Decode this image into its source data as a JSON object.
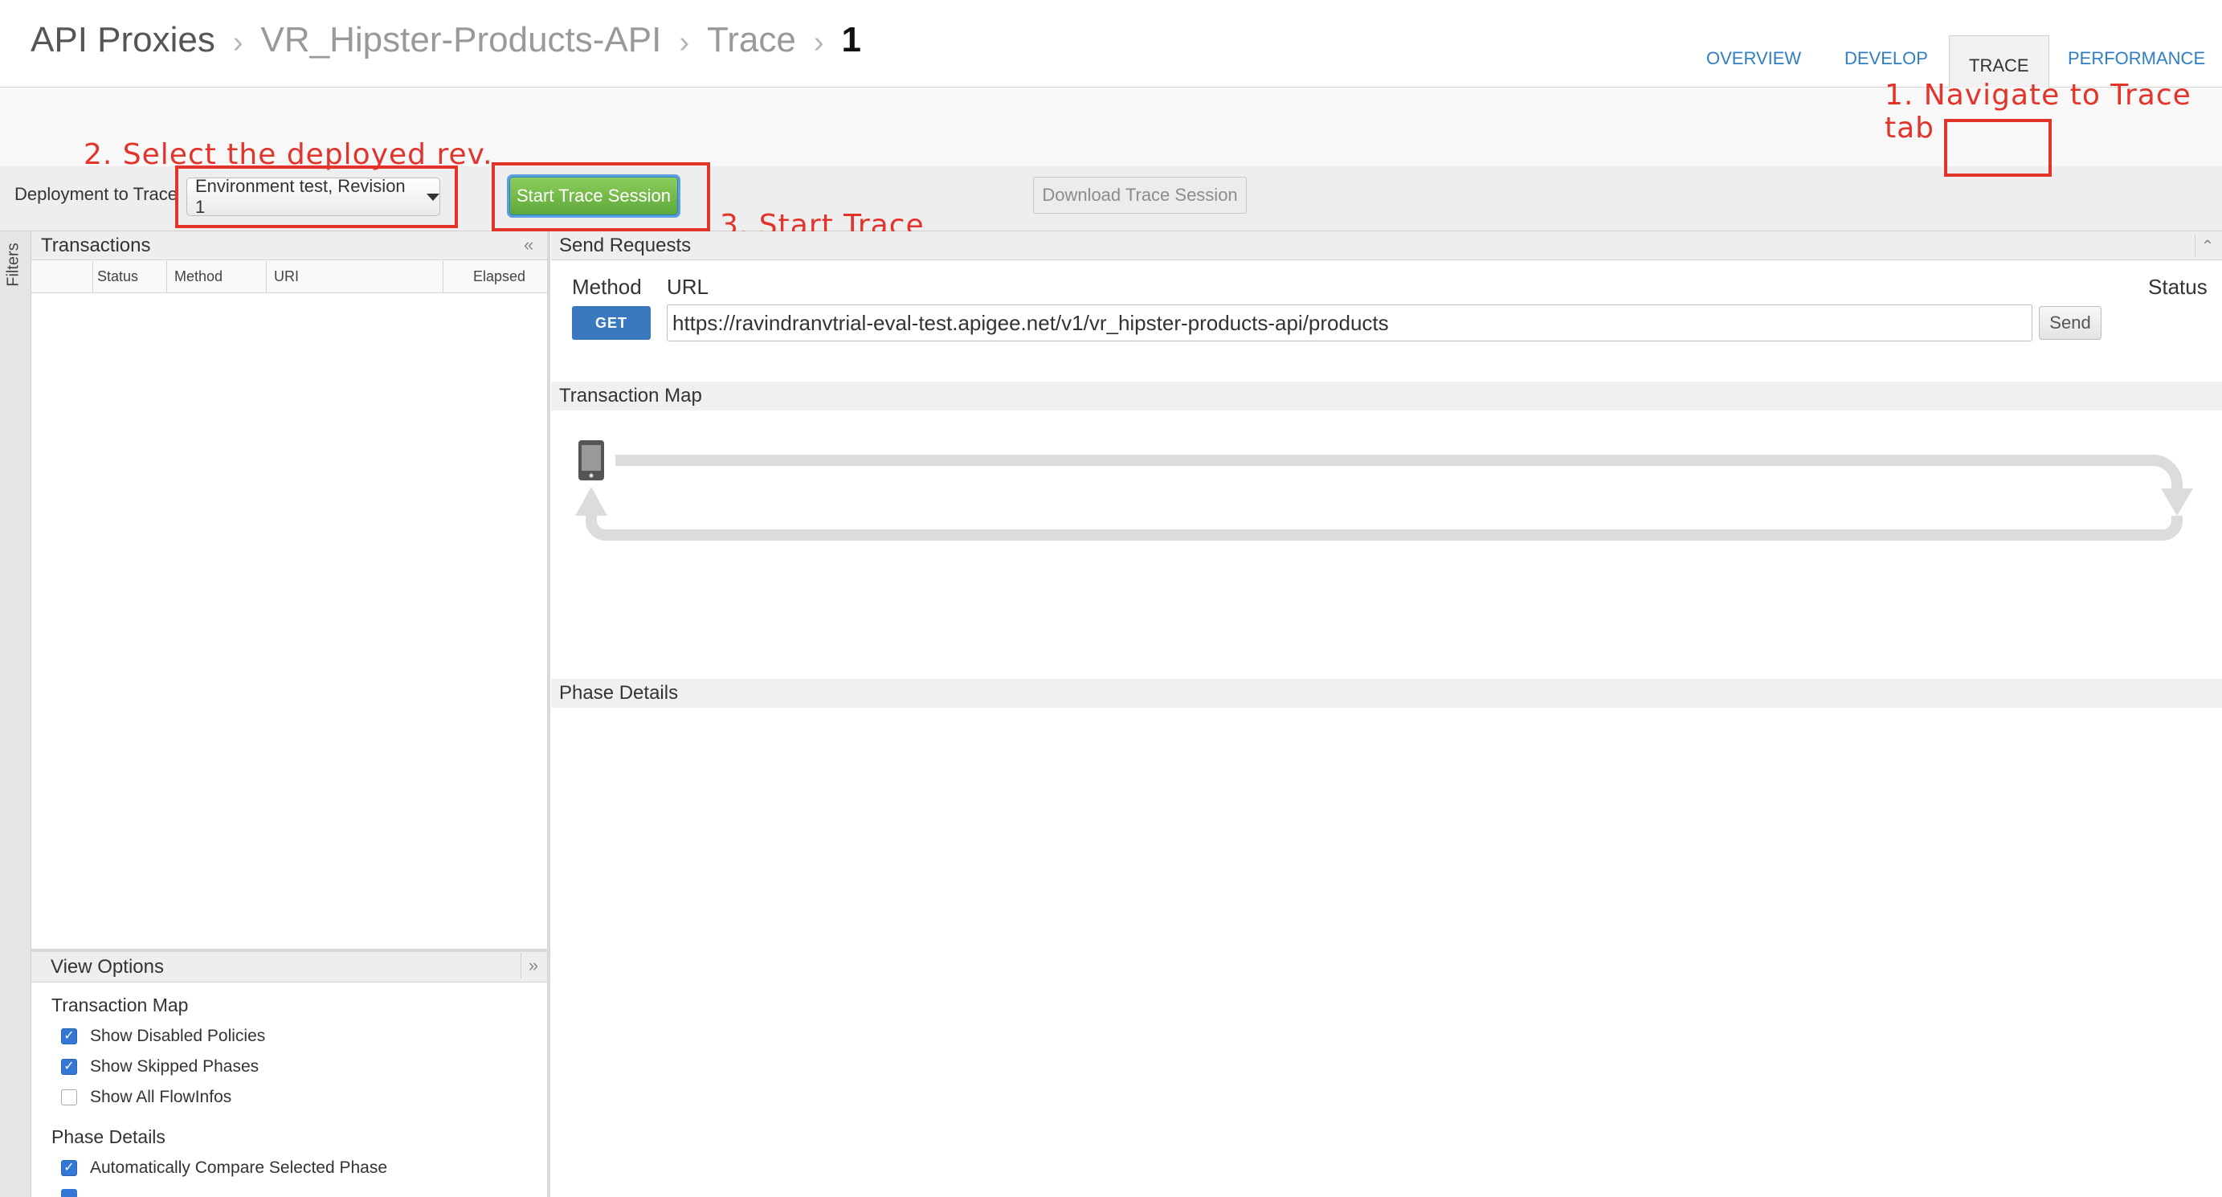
{
  "breadcrumb": {
    "items": [
      "API Proxies",
      "VR_Hipster-Products-API",
      "Trace",
      "1"
    ],
    "separator": "›"
  },
  "tabs": [
    {
      "label": "OVERVIEW",
      "active": false
    },
    {
      "label": "DEVELOP",
      "active": false
    },
    {
      "label": "TRACE",
      "active": true
    },
    {
      "label": "PERFORMANCE",
      "active": false
    }
  ],
  "annotations": {
    "step1": "1. Navigate to Trace tab",
    "step2": "2. Select the deployed rev.",
    "step3": "3. Start Trace",
    "color": "#e2342b"
  },
  "toolbar": {
    "deployment_label": "Deployment to Trace",
    "deployment_value": "Environment test, Revision 1",
    "start_label": "Start Trace Session",
    "download_label": "Download Trace Session"
  },
  "filters_label": "Filters",
  "transactions": {
    "title": "Transactions",
    "columns": [
      "Status",
      "Method",
      "URI",
      "Elapsed"
    ],
    "rows": []
  },
  "send_requests": {
    "title": "Send Requests",
    "method_label": "Method",
    "url_label": "URL",
    "status_label": "Status",
    "method_value": "GET",
    "url_value": "https://ravindranvtrial-eval-test.apigee.net/v1/vr_hipster-products-api/products",
    "send_label": "Send"
  },
  "transaction_map": {
    "title": "Transaction Map"
  },
  "phase_details": {
    "title": "Phase Details"
  },
  "view_options": {
    "title": "View Options",
    "transaction_map_heading": "Transaction Map",
    "transaction_map_options": [
      {
        "label": "Show Disabled Policies",
        "checked": true
      },
      {
        "label": "Show Skipped Phases",
        "checked": true
      },
      {
        "label": "Show All FlowInfos",
        "checked": false
      }
    ],
    "phase_details_heading": "Phase Details",
    "phase_details_options": [
      {
        "label": "Automatically Compare Selected Phase",
        "checked": true
      }
    ]
  },
  "colors": {
    "accent_blue": "#2f7ec4",
    "start_green": "#6db545",
    "get_blue": "#3a78c0",
    "checkbox_blue": "#3577d4"
  }
}
